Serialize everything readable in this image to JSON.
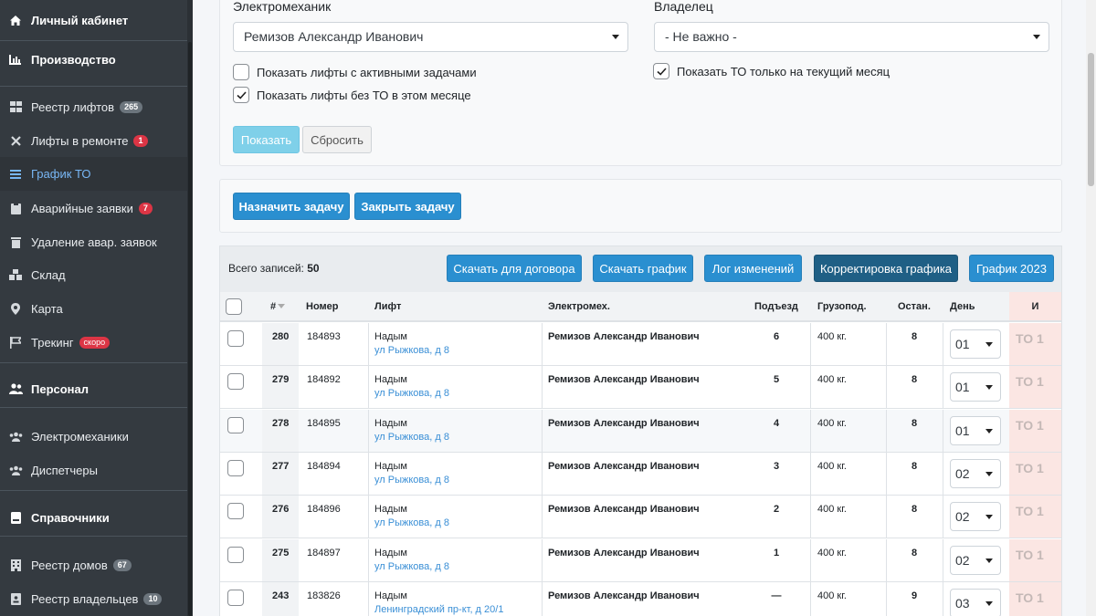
{
  "sidebar": {
    "cabinet": "Личный кабинет",
    "production": "Производство",
    "lifts_registry": "Реестр лифтов",
    "lifts_registry_count": "265",
    "repairs": "Лифты в ремонте",
    "repairs_count": "1",
    "schedule": "График ТО",
    "emergency": "Аварийные заявки",
    "emergency_count": "7",
    "delete_emergency": "Удаление авар. заявок",
    "warehouse": "Склад",
    "map": "Карта",
    "tracking": "Трекинг",
    "tracking_badge": "скоро",
    "personnel": "Персонал",
    "electricians": "Электромеханики",
    "dispatchers": "Диспетчеры",
    "directories": "Справочники",
    "houses": "Реестр домов",
    "houses_count": "67",
    "owners": "Реестр владельцев",
    "owners_count": "10"
  },
  "filters": {
    "electrician_label": "Электромеханик",
    "electrician_value": "Ремизов Александр Иванович",
    "owner_label": "Владелец",
    "owner_value": "- Не важно -",
    "cb_active_tasks": "Показать лифты с активными задачами",
    "cb_no_to": "Показать лифты без ТО в этом месяце",
    "cb_current_month": "Показать ТО только на текущий месяц",
    "show_btn": "Показать",
    "reset_btn": "Сбросить"
  },
  "actions": {
    "assign": "Назначить задачу",
    "close": "Закрыть задачу"
  },
  "table": {
    "total_label": "Всего записей:",
    "total_value": "50",
    "btn_contract": "Скачать для договора",
    "btn_schedule": "Скачать график",
    "btn_log": "Лог изменений",
    "btn_correct": "Корректировка графика",
    "btn_2023": "График 2023",
    "headers": {
      "num": "#",
      "number": "Номер",
      "lift": "Лифт",
      "electrician": "Электромех.",
      "entrance": "Подъезд",
      "capacity": "Грузопод.",
      "stops": "Остан.",
      "day": "День",
      "last": "И"
    },
    "rows": [
      {
        "id": "280",
        "number": "184893",
        "city": "Надым",
        "address": "ул Рыжкова, д 8",
        "electrician": "Ремизов Александр Иванович",
        "entrance": "6",
        "capacity": "400 кг.",
        "stops": "8",
        "day": "01",
        "to": "ТО 1"
      },
      {
        "id": "279",
        "number": "184892",
        "city": "Надым",
        "address": "ул Рыжкова, д 8",
        "electrician": "Ремизов Александр Иванович",
        "entrance": "5",
        "capacity": "400 кг.",
        "stops": "8",
        "day": "01",
        "to": "ТО 1"
      },
      {
        "id": "278",
        "number": "184895",
        "city": "Надым",
        "address": "ул Рыжкова, д 8",
        "electrician": "Ремизов Александр Иванович",
        "entrance": "4",
        "capacity": "400 кг.",
        "stops": "8",
        "day": "01",
        "to": "ТО 1"
      },
      {
        "id": "277",
        "number": "184894",
        "city": "Надым",
        "address": "ул Рыжкова, д 8",
        "electrician": "Ремизов Александр Иванович",
        "entrance": "3",
        "capacity": "400 кг.",
        "stops": "8",
        "day": "02",
        "to": "ТО 1"
      },
      {
        "id": "276",
        "number": "184896",
        "city": "Надым",
        "address": "ул Рыжкова, д 8",
        "electrician": "Ремизов Александр Иванович",
        "entrance": "2",
        "capacity": "400 кг.",
        "stops": "8",
        "day": "02",
        "to": "ТО 1"
      },
      {
        "id": "275",
        "number": "184897",
        "city": "Надым",
        "address": "ул Рыжкова, д 8",
        "electrician": "Ремизов Александр Иванович",
        "entrance": "1",
        "capacity": "400 кг.",
        "stops": "8",
        "day": "02",
        "to": "ТО 1"
      },
      {
        "id": "243",
        "number": "183826",
        "city": "Надым",
        "address": "Ленинградский пр-кт, д 20/1",
        "electrician": "Ремизов Александр Иванович",
        "entrance": "—",
        "capacity": "400 кг.",
        "stops": "9",
        "day": "03",
        "to": "ТО 1"
      }
    ]
  }
}
